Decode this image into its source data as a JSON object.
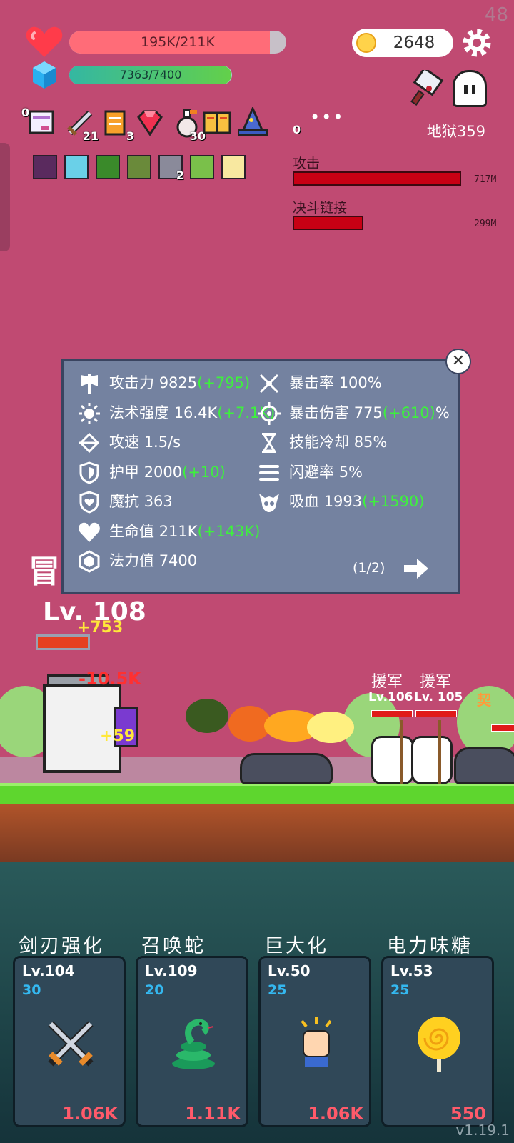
{
  "fps": "48",
  "player": {
    "hp_text": "195K/211K",
    "hp_fraction": 0.924,
    "mp_text": "7363/7400",
    "mp_fraction": 0.995,
    "level": "Lv. 108",
    "adventure_char": "冒"
  },
  "currency": {
    "coins": "2648"
  },
  "stage": "地狱359",
  "items": [
    {
      "icon": "scroll-bag-icon",
      "count": "0"
    },
    {
      "icon": "sword-icon",
      "count": "21"
    },
    {
      "icon": "scroll-icon",
      "count": "3"
    },
    {
      "icon": "ruby-icon",
      "count": ""
    },
    {
      "icon": "potion-icon",
      "count": "30"
    },
    {
      "icon": "book-icon",
      "count": ""
    },
    {
      "icon": "wizard-hat-icon",
      "count": ""
    }
  ],
  "more_items": {
    "label": "•••",
    "count": "0"
  },
  "buffs": [
    {
      "icon": "demon-buff-icon",
      "color": "#5a2a5e",
      "count": ""
    },
    {
      "icon": "lightbulb-buff-icon",
      "color": "#6ad0e8",
      "count": ""
    },
    {
      "icon": "leaf-buff-icon",
      "color": "#3a8a2a",
      "count": ""
    },
    {
      "icon": "camo-buff-icon",
      "color": "#6a8a3a",
      "count": ""
    },
    {
      "icon": "blade-buff-icon",
      "color": "#8a8a9a",
      "count": "2"
    },
    {
      "icon": "sprout-buff-icon",
      "color": "#7ac04a",
      "count": ""
    },
    {
      "icon": "sparkle-buff-icon",
      "color": "#f8e8a0",
      "count": ""
    }
  ],
  "dps": [
    {
      "label": "攻击",
      "value": "717M",
      "fraction": 1.0
    },
    {
      "label": "决斗链接",
      "value": "299M",
      "fraction": 0.42
    }
  ],
  "stats_panel": {
    "left": [
      {
        "icon": "axe-icon",
        "label": "攻击力",
        "value": "9825",
        "bonus": "(+795)",
        "suffix": ""
      },
      {
        "icon": "sun-icon",
        "label": "法术强度",
        "value": "16.4K",
        "bonus": "(+7.1K)",
        "suffix": ""
      },
      {
        "icon": "arrow-speed-icon",
        "label": "攻速",
        "value": "1.5/s",
        "bonus": "",
        "suffix": ""
      },
      {
        "icon": "shield-icon",
        "label": "护甲",
        "value": "2000",
        "bonus": "(+10)",
        "suffix": ""
      },
      {
        "icon": "magic-shield-icon",
        "label": "魔抗",
        "value": "363",
        "bonus": "",
        "suffix": ""
      },
      {
        "icon": "heart-icon",
        "label": "生命值",
        "value": "211K",
        "bonus": "(+143K)",
        "suffix": ""
      },
      {
        "icon": "mana-crystal-icon",
        "label": "法力值",
        "value": "7400",
        "bonus": "",
        "suffix": ""
      }
    ],
    "right": [
      {
        "icon": "crossed-swords-icon",
        "label": "暴击率",
        "value": "100%",
        "bonus": "",
        "suffix": ""
      },
      {
        "icon": "crit-damage-icon",
        "label": "暴击伤害",
        "value": "775",
        "bonus": "(+610)",
        "suffix": "%"
      },
      {
        "icon": "hourglass-icon",
        "label": "技能冷却",
        "value": "85%",
        "bonus": "",
        "suffix": ""
      },
      {
        "icon": "dodge-icon",
        "label": "闪避率",
        "value": "5%",
        "bonus": "",
        "suffix": ""
      },
      {
        "icon": "vampire-skull-icon",
        "label": "吸血",
        "value": "1993",
        "bonus": "(+1590)",
        "suffix": ""
      }
    ],
    "page": "(1/2)"
  },
  "battle": {
    "damage_numbers": [
      "-10.5K",
      "+753",
      "+59"
    ],
    "enemy_names": [
      "援军",
      "援军",
      "援军"
    ],
    "enemy_levels": [
      "Lv.106",
      "Lv. 105"
    ],
    "enemy_right_label": "契"
  },
  "skills": [
    {
      "name": "剑刃强化",
      "level": "Lv.104",
      "cost": "30",
      "price": "1.06K",
      "icon": "crossed-swords-skill-icon"
    },
    {
      "name": "召唤蛇",
      "level": "Lv.109",
      "cost": "20",
      "price": "1.11K",
      "icon": "snake-skill-icon"
    },
    {
      "name": "巨大化",
      "level": "Lv.50",
      "cost": "25",
      "price": "1.06K",
      "icon": "fist-skill-icon"
    },
    {
      "name": "电力味糖",
      "level": "Lv.53",
      "cost": "25",
      "price": "550",
      "icon": "lollipop-skill-icon"
    }
  ],
  "version": "v1.19.1",
  "colors": {
    "background": "#c04a72",
    "hp": "#ff6c78",
    "mp": "#34b7a2",
    "bonus": "#3ef03e",
    "price": "#ff5a6a",
    "skill_cost": "#34b8f0"
  }
}
